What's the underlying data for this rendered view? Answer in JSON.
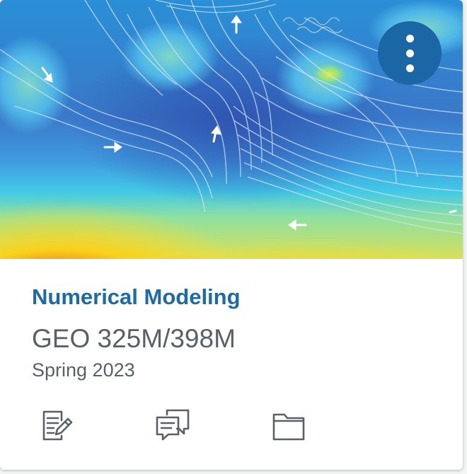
{
  "card": {
    "course_name": "Numerical Modeling",
    "course_code": "GEO 325M/398M",
    "term": "Spring 2023"
  },
  "menu": {
    "icon": "kebab-vertical-icon"
  },
  "actions": [
    {
      "name": "assignments",
      "icon": "assignment-edit-icon"
    },
    {
      "name": "discussions",
      "icon": "discussions-icon"
    },
    {
      "name": "files",
      "icon": "folder-icon"
    }
  ],
  "colors": {
    "accent": "#1e6aa8",
    "menu_button": "#1b67a6",
    "text_secondary": "#596067",
    "icon": "#596067"
  }
}
